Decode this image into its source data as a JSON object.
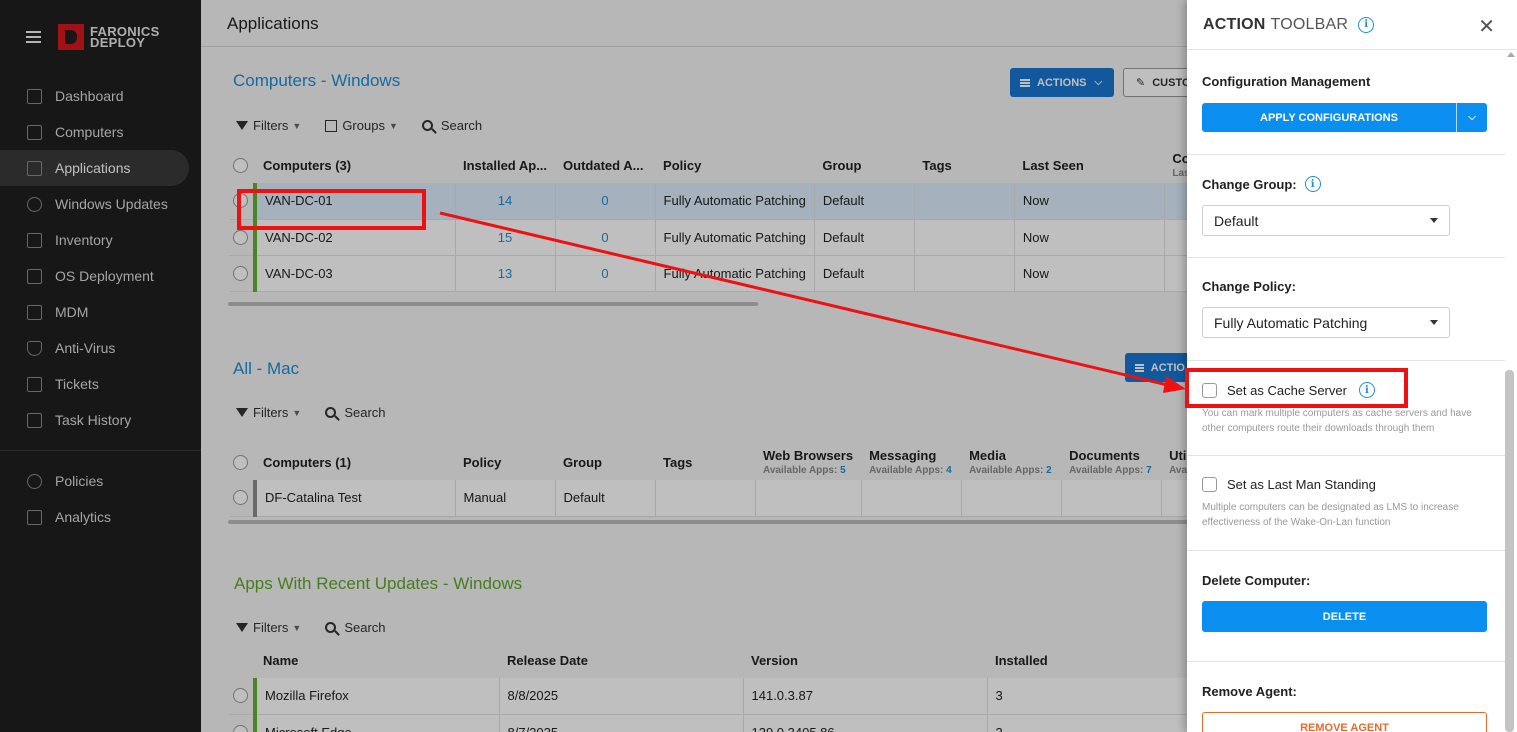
{
  "brand": {
    "line1": "FARONICS",
    "line2": "DEPLOY"
  },
  "sidebar": {
    "items": [
      {
        "label": "Dashboard",
        "icon": "dashboard-icon"
      },
      {
        "label": "Computers",
        "icon": "monitor-icon"
      },
      {
        "label": "Applications",
        "icon": "box-icon",
        "active": true
      },
      {
        "label": "Windows Updates",
        "icon": "refresh-icon"
      },
      {
        "label": "Inventory",
        "icon": "clipboard-icon"
      },
      {
        "label": "OS Deployment",
        "icon": "download-icon"
      },
      {
        "label": "MDM",
        "icon": "phone-icon"
      },
      {
        "label": "Anti-Virus",
        "icon": "shield-icon"
      },
      {
        "label": "Tickets",
        "icon": "ticket-icon"
      },
      {
        "label": "Task History",
        "icon": "list-icon"
      }
    ],
    "items2": [
      {
        "label": "Policies",
        "icon": "gear-icon"
      },
      {
        "label": "Analytics",
        "icon": "list-icon"
      }
    ]
  },
  "page": {
    "title": "Applications"
  },
  "windows": {
    "title": "Computers - Windows",
    "actions": "ACTIONS",
    "custom": "CUSTO",
    "filters": "Filters",
    "groups": "Groups",
    "search": "Search",
    "headers": [
      "Computers (3)",
      "Installed Ap...",
      "Outdated A...",
      "Policy",
      "Group",
      "Tags",
      "Last Seen",
      "Co"
    ],
    "header_sub": "Last",
    "rows": [
      {
        "name": "VAN-DC-01",
        "installed": "14",
        "outdated": "0",
        "policy": "Fully Automatic Patching",
        "group": "Default",
        "tags": "",
        "last_seen": "Now"
      },
      {
        "name": "VAN-DC-02",
        "installed": "15",
        "outdated": "0",
        "policy": "Fully Automatic Patching",
        "group": "Default",
        "tags": "",
        "last_seen": "Now"
      },
      {
        "name": "VAN-DC-03",
        "installed": "13",
        "outdated": "0",
        "policy": "Fully Automatic Patching",
        "group": "Default",
        "tags": "",
        "last_seen": "Now"
      }
    ]
  },
  "mac": {
    "title": "All - Mac",
    "actions": "ACTIO",
    "filters": "Filters",
    "search": "Search",
    "headers": [
      "Computers (1)",
      "Policy",
      "Group",
      "Tags",
      "Web Browsers",
      "Messaging",
      "Media",
      "Documents",
      "Util"
    ],
    "subs": [
      {
        "label": "Available Apps:",
        "count": "5"
      },
      {
        "label": "Available Apps:",
        "count": "4"
      },
      {
        "label": "Available Apps:",
        "count": "2"
      },
      {
        "label": "Available Apps:",
        "count": "7"
      },
      {
        "label": "Avail",
        "count": ""
      }
    ],
    "rows": [
      {
        "name": "DF-Catalina Test",
        "policy": "Manual",
        "group": "Default",
        "tags": ""
      }
    ]
  },
  "updates": {
    "title": "Apps With Recent Updates - Windows",
    "filters": "Filters",
    "search": "Search",
    "headers": [
      "Name",
      "Release Date",
      "Version",
      "Installed"
    ],
    "rows": [
      {
        "name": "Mozilla Firefox",
        "date": "8/8/2025",
        "version": "141.0.3.87",
        "installed": "3"
      },
      {
        "name": "Microsoft Edge",
        "date": "8/7/2025",
        "version": "139.0.3405.86",
        "installed": "3"
      }
    ]
  },
  "panel": {
    "title1": "ACTION",
    "title2": "TOOLBAR",
    "config_label": "Configuration Management",
    "apply_btn": "APPLY CONFIGURATIONS",
    "group_label": "Change Group:",
    "group_value": "Default",
    "policy_label": "Change Policy:",
    "policy_value": "Fully Automatic Patching",
    "cache_label": "Set as Cache Server",
    "cache_help": "You can mark multiple computers as cache servers and have other computers route their downloads through them",
    "lms_label": "Set as Last Man Standing",
    "lms_help": "Multiple computers can be designated as LMS to increase effectiveness of the Wake-On-Lan function",
    "delete_label": "Delete Computer:",
    "delete_btn": "DELETE",
    "remove_label": "Remove Agent:",
    "remove_btn": "REMOVE AGENT"
  },
  "colors": {
    "accent": "#0a8ef0",
    "sidebar": "#1f1f1f",
    "green": "#62b22f",
    "annotation": "#ee1111"
  }
}
